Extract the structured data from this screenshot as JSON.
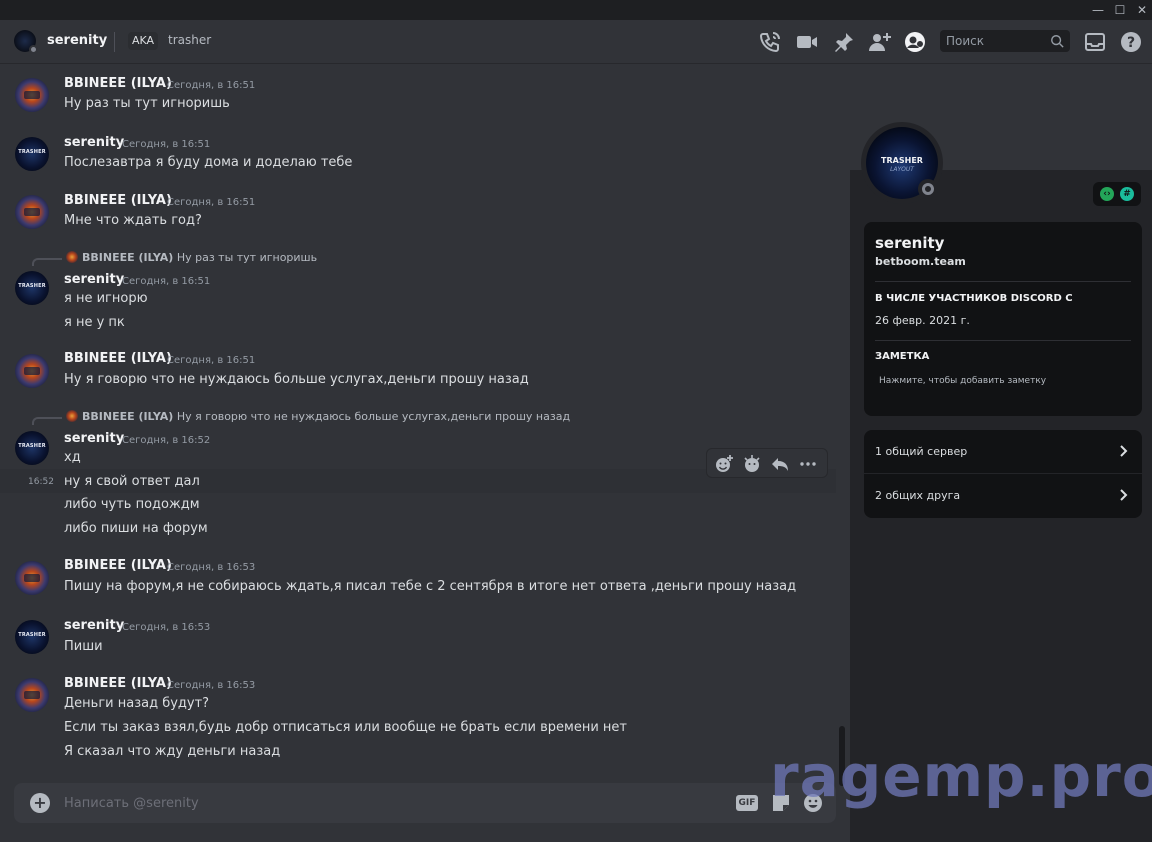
{
  "header": {
    "channel_name": "serenity",
    "aka_label": "AKA",
    "alias": "trasher",
    "icons": [
      "phone-call-icon",
      "video-camera-icon",
      "pin-icon",
      "add-friend-icon",
      "user-profile-icon"
    ],
    "search_placeholder": "Поиск",
    "right_icons": [
      "inbox-icon",
      "help-icon"
    ]
  },
  "messages": [
    {
      "author": "BBINEEE (ILYA)",
      "time": "Сегодня, в 16:51",
      "lines": [
        "Ну раз ты тут игноришь"
      ]
    },
    {
      "author": "serenity",
      "time": "Сегодня, в 16:51",
      "lines": [
        "Послезавтра я буду дома и доделаю тебе"
      ]
    },
    {
      "author": "BBINEEE (ILYA)",
      "time": "Сегодня, в 16:51",
      "lines": [
        "Мне что ждать год?"
      ]
    },
    {
      "reply_author": "BBINEEE (ILYA)",
      "reply_text": "Ну раз ты тут игноришь",
      "author": "serenity",
      "time": "Сегодня, в 16:51",
      "lines": [
        "я не игнорю",
        "я не у пк"
      ]
    },
    {
      "author": "BBINEEE (ILYA)",
      "time": "Сегодня, в 16:51",
      "lines": [
        "Ну я говорю что не нуждаюсь больше услугах,деньги прошу назад"
      ]
    },
    {
      "reply_author": "BBINEEE (ILYA)",
      "reply_text": "Ну я говорю что не нуждаюсь больше услугах,деньги прошу назад",
      "author": "serenity",
      "time": "Сегодня, в 16:52",
      "lines": [
        "хд",
        "ну я свой ответ дал",
        "либо чуть подождм",
        "либо пиши на форум"
      ],
      "hover_time": "16:52"
    },
    {
      "author": "BBINEEE (ILYA)",
      "time": "Сегодня, в 16:53",
      "lines": [
        "Пишу на форум,я не собираюсь ждать,я писал тебе с 2 сентября в итоге нет ответа ,деньги прошу назад"
      ]
    },
    {
      "author": "serenity",
      "time": "Сегодня, в 16:53",
      "lines": [
        "Пиши"
      ]
    },
    {
      "author": "BBINEEE (ILYA)",
      "time": "Сегодня, в 16:53",
      "lines": [
        "Деньги назад будут?",
        "Если ты заказ взял,будь добр отписаться или вообще не брать если времени нет",
        "Я сказал что жду деньги назад"
      ]
    }
  ],
  "composer": {
    "placeholder": "Написать @serenity",
    "gif_label": "GIF"
  },
  "profile": {
    "avatar_text": "TRASHER",
    "avatar_subtext": "LAYOUT",
    "display_name": "serenity",
    "username": "betboom.team",
    "member_since_title": "В ЧИСЛЕ УЧАСТНИКОВ DISCORD С",
    "member_since_value": "26 февр. 2021 г.",
    "note_title": "ЗАМЕТКА",
    "note_placeholder": "Нажмите, чтобы добавить заметку",
    "mutual_servers": "1 общий сервер",
    "mutual_friends": "2 общих друга",
    "badge_colors": [
      "#23a559",
      "#1abc9c"
    ]
  },
  "watermark": "ragemp.pro",
  "colors": {
    "background": "#313338",
    "panel": "#232428",
    "card": "#111214",
    "text": "#dbdee1"
  }
}
